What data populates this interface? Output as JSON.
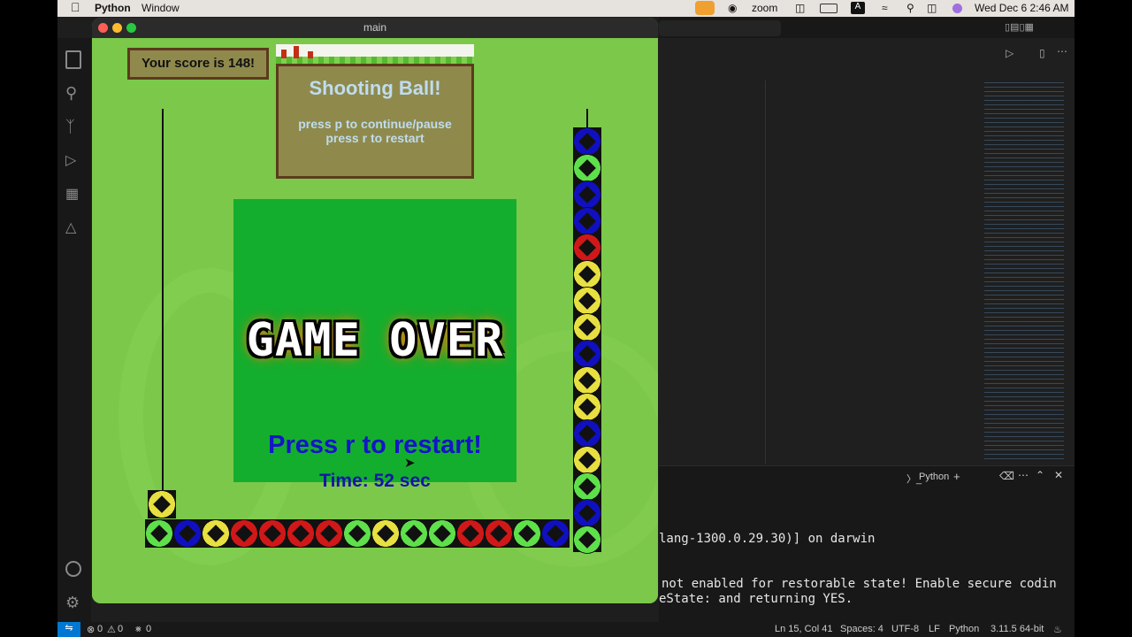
{
  "menubar": {
    "app": "Python",
    "window_menu": "Window",
    "zoom": "zoom",
    "clock": "Wed Dec 6  2:46 AM",
    "input_source": "A"
  },
  "game_window": {
    "title": "main"
  },
  "game": {
    "score_text": "Your score is 148!",
    "title": "Shooting Ball!",
    "help_line1": "press p to continue/pause",
    "help_line2": "press r to restart",
    "game_over": "GAME OVER",
    "restart_prompt": "Press r to restart!",
    "time_text": "Time: 52 sec",
    "colors": {
      "blue": "#1010c0",
      "green": "#5ee04a",
      "red": "#d01818",
      "yellow": "#e8e040"
    },
    "bottom_row": [
      "green",
      "blue",
      "yellow",
      "red",
      "red",
      "red",
      "red",
      "green",
      "yellow",
      "green",
      "green",
      "red",
      "red",
      "green",
      "blue"
    ],
    "right_column": [
      "blue",
      "green",
      "blue",
      "blue",
      "red",
      "yellow",
      "yellow",
      "yellow",
      "blue",
      "yellow",
      "yellow",
      "blue",
      "yellow",
      "green",
      "blue",
      "green"
    ],
    "corner_ball": "yellow"
  },
  "terminal": {
    "line1": "lang-1300.0.29.30)] on darwin",
    "line2": "not enabled for restorable state! Enable secure codin",
    "line3": "eState: and returning YES.",
    "panel_label": "Python"
  },
  "statusbar": {
    "errors": "0",
    "warnings": "0",
    "ports": "0",
    "position": "Ln 15, Col 41",
    "spaces": "Spaces: 4",
    "encoding": "UTF-8",
    "eol": "LF",
    "language": "Python",
    "interpreter": "3.11.5 64-bit"
  }
}
